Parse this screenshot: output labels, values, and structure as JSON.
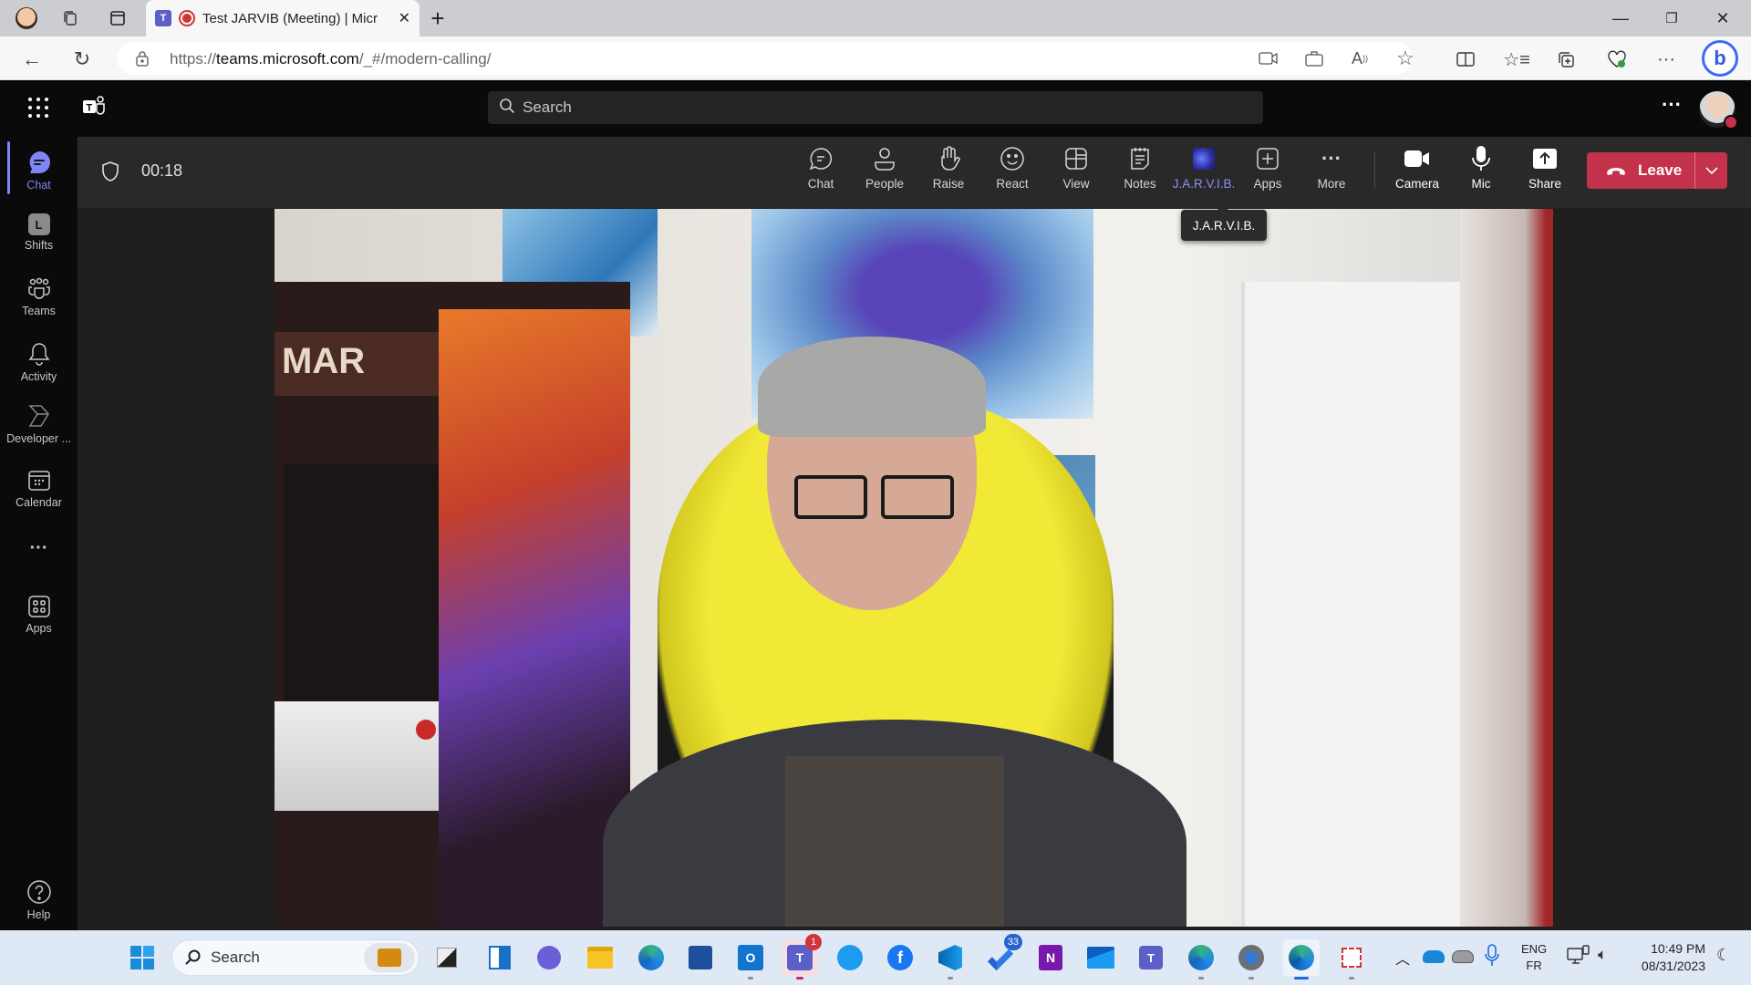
{
  "browser": {
    "tab_title": "Test JARVIB (Meeting) | Micr",
    "url_prefix": "https://",
    "url_host": "teams.microsoft.com",
    "url_path": "/_#/modern-calling/",
    "window_controls": {
      "minimize": "—",
      "restore": "❐",
      "close": "✕"
    },
    "toolbar_icons": [
      "camera-icon",
      "briefcase-icon",
      "read-aloud-icon",
      "favorite-star-icon",
      "split-screen-icon",
      "favorites-icon",
      "collections-icon",
      "browser-essentials-icon",
      "more-icon",
      "bing-copilot-icon"
    ]
  },
  "teams_header": {
    "search_placeholder": "Search",
    "more_label": "···"
  },
  "rail": {
    "items": [
      {
        "label": "Chat",
        "icon": "chat-icon",
        "active": true
      },
      {
        "label": "Shifts",
        "icon": "shifts-icon"
      },
      {
        "label": "Teams",
        "icon": "teams-icon"
      },
      {
        "label": "Activity",
        "icon": "bell-icon"
      },
      {
        "label": "Developer ...",
        "icon": "developer-portal-icon"
      },
      {
        "label": "Calendar",
        "icon": "calendar-icon"
      },
      {
        "label": "···",
        "icon": "more-apps-icon"
      },
      {
        "label": "Apps",
        "icon": "apps-icon"
      }
    ],
    "help_label": "Help"
  },
  "meeting": {
    "timer": "00:18",
    "buttons": [
      {
        "label": "Chat",
        "icon": "chat-icon"
      },
      {
        "label": "People",
        "icon": "people-icon"
      },
      {
        "label": "Raise",
        "icon": "raise-hand-icon"
      },
      {
        "label": "React",
        "icon": "smiley-icon"
      },
      {
        "label": "View",
        "icon": "view-layout-icon"
      },
      {
        "label": "Notes",
        "icon": "notes-icon"
      },
      {
        "label": "J.A.R.V.I.B.",
        "icon": "jarvib-app-icon"
      },
      {
        "label": "Apps",
        "icon": "add-apps-icon"
      },
      {
        "label": "More",
        "icon": "more-icon"
      }
    ],
    "device_buttons": [
      {
        "label": "Camera",
        "icon": "camera-icon"
      },
      {
        "label": "Mic",
        "icon": "mic-icon"
      },
      {
        "label": "Share",
        "icon": "share-icon"
      }
    ],
    "leave_label": "Leave",
    "tooltip": "J.A.R.V.I.B.",
    "accent_color": "#7f85f5",
    "leave_color": "#c4314b"
  },
  "taskbar": {
    "search_placeholder": "Search",
    "apps": [
      {
        "name": "work-briefcase"
      },
      {
        "name": "task-view"
      },
      {
        "name": "widgets"
      },
      {
        "name": "teams-chat"
      },
      {
        "name": "file-explorer"
      },
      {
        "name": "edge-profile"
      },
      {
        "name": "microsoft-store"
      },
      {
        "name": "outlook"
      },
      {
        "name": "teams",
        "badge": "1"
      },
      {
        "name": "twitter"
      },
      {
        "name": "facebook"
      },
      {
        "name": "vscode"
      },
      {
        "name": "todo",
        "badge": "33"
      },
      {
        "name": "onenote"
      },
      {
        "name": "mail"
      },
      {
        "name": "teams-new"
      },
      {
        "name": "edge-profile-2"
      },
      {
        "name": "settings"
      },
      {
        "name": "edge"
      },
      {
        "name": "snipping-tool"
      }
    ],
    "tray": {
      "lang_top": "ENG",
      "lang_bottom": "FR",
      "time": "10:49 PM",
      "date": "08/31/2023"
    }
  }
}
